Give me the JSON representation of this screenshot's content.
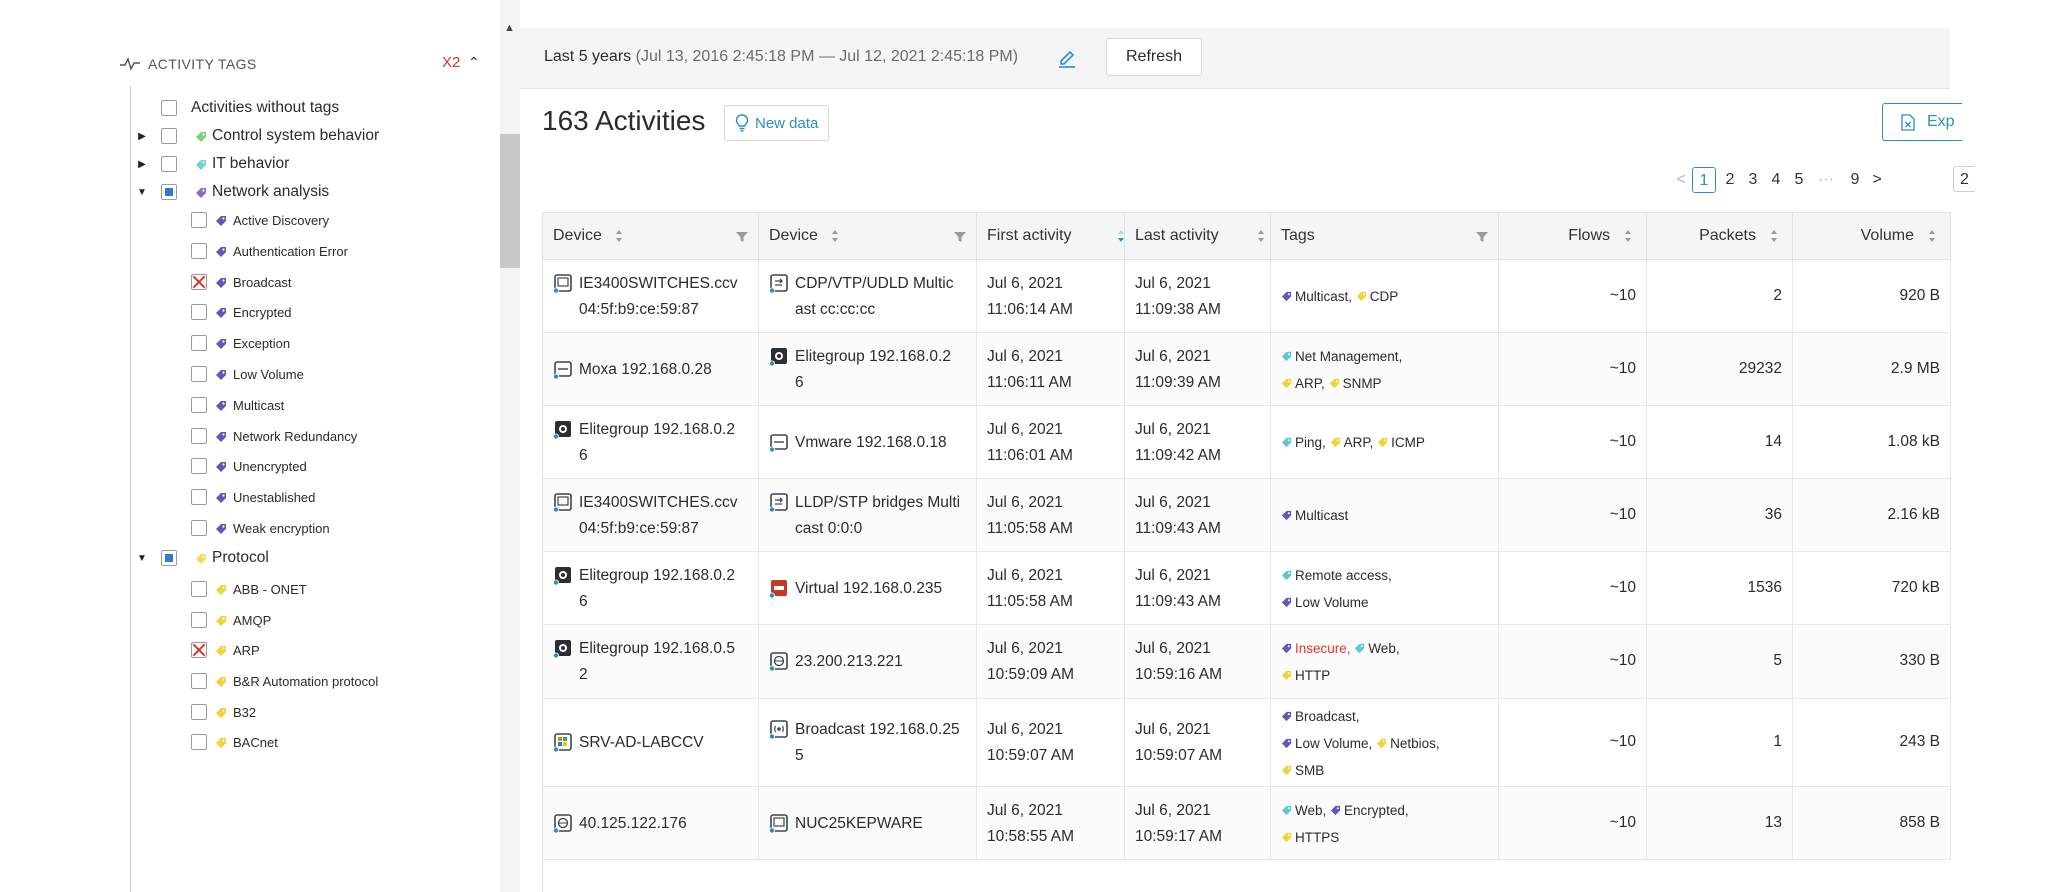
{
  "activity_tags": {
    "header": "ACTIVITY TAGS",
    "filter_count": "X2",
    "items": [
      {
        "label": "Activities without tags",
        "level": 1,
        "expand": "",
        "check": "none",
        "color": ""
      },
      {
        "label": "Control system behavior",
        "level": 1,
        "expand": "collapsed",
        "check": "none",
        "color": "#7ed37a"
      },
      {
        "label": "IT behavior",
        "level": 1,
        "expand": "collapsed",
        "check": "none",
        "color": "#6fd0d8"
      },
      {
        "label": "Network analysis",
        "level": 1,
        "expand": "expanded",
        "check": "partial",
        "color": "#8a6bc9"
      },
      {
        "label": "Active Discovery",
        "level": 2,
        "check": "none",
        "color": "#6a54b8"
      },
      {
        "label": "Authentication Error",
        "level": 2,
        "check": "none",
        "color": "#6a54b8"
      },
      {
        "label": "Broadcast",
        "level": 2,
        "check": "cross",
        "color": "#6a54b8"
      },
      {
        "label": "Encrypted",
        "level": 2,
        "check": "none",
        "color": "#6a54b8"
      },
      {
        "label": "Exception",
        "level": 2,
        "check": "none",
        "color": "#6a54b8"
      },
      {
        "label": "Low Volume",
        "level": 2,
        "check": "none",
        "color": "#6a54b8"
      },
      {
        "label": "Multicast",
        "level": 2,
        "check": "none",
        "color": "#6a54b8"
      },
      {
        "label": "Network Redundancy",
        "level": 2,
        "check": "none",
        "color": "#6a54b8"
      },
      {
        "label": "Unencrypted",
        "level": 2,
        "check": "none",
        "color": "#6a54b8"
      },
      {
        "label": "Unestablished",
        "level": 2,
        "check": "none",
        "color": "#6a54b8"
      },
      {
        "label": "Weak encryption",
        "level": 2,
        "check": "none",
        "color": "#6a54b8"
      },
      {
        "label": "Protocol",
        "level": 1,
        "expand": "expanded",
        "check": "partial",
        "color": "#f5dc5a"
      },
      {
        "label": "ABB - ONET",
        "level": 2,
        "check": "none",
        "color": "#f0d33a"
      },
      {
        "label": "AMQP",
        "level": 2,
        "check": "none",
        "color": "#f0d33a"
      },
      {
        "label": "ARP",
        "level": 2,
        "check": "cross",
        "color": "#f0d33a"
      },
      {
        "label": "B&R Automation protocol",
        "level": 2,
        "check": "none",
        "color": "#f0d33a"
      },
      {
        "label": "B32",
        "level": 2,
        "check": "none",
        "color": "#f0d33a"
      },
      {
        "label": "BACnet",
        "level": 2,
        "check": "none",
        "color": "#f0d33a"
      }
    ]
  },
  "toolbar": {
    "range_main": "Last 5 years",
    "range_sub": "(Jul 13, 2016 2:45:18 PM — Jul 12, 2021 2:45:18 PM)",
    "refresh_label": "Refresh",
    "edit_icon": "pencil-icon"
  },
  "summary": {
    "title": "163 Activities",
    "new_data_label": "New data",
    "export_label": "Exp"
  },
  "pagination": {
    "prev": "<",
    "pages": [
      "1",
      "2",
      "3",
      "4",
      "5"
    ],
    "ellipsis": "···",
    "last_page": "9",
    "next": ">",
    "page_size_fragment": "2",
    "current": "1"
  },
  "table": {
    "columns": [
      {
        "key": "device1",
        "label": "Device",
        "sort": "none",
        "filter": true
      },
      {
        "key": "device2",
        "label": "Device",
        "sort": "none",
        "filter": true
      },
      {
        "key": "first",
        "label": "First activity",
        "sort": "desc",
        "filter": false
      },
      {
        "key": "last",
        "label": "Last activity",
        "sort": "none",
        "filter": false
      },
      {
        "key": "tags",
        "label": "Tags",
        "sort": "",
        "filter": true
      },
      {
        "key": "flows",
        "label": "Flows",
        "sort": "none",
        "filter": false
      },
      {
        "key": "packets",
        "label": "Packets",
        "sort": "none",
        "filter": false
      },
      {
        "key": "volume",
        "label": "Volume",
        "sort": "none",
        "filter": false
      }
    ],
    "rows": [
      {
        "device1": {
          "icon": "switch-icon",
          "line1": "IE3400SWITCHES.ccv",
          "line2": "04:5f:b9:ce:59:87"
        },
        "device2": {
          "icon": "multicast-icon",
          "line1": "CDP/VTP/UDLD Multic",
          "line2": "ast cc:cc:cc"
        },
        "first": [
          "Jul 6, 2021",
          "11:06:14 AM"
        ],
        "last": [
          "Jul 6, 2021",
          "11:09:38 AM"
        ],
        "tags": [
          [
            {
              "label": "Multicast",
              "color": "#6a54b8",
              "sep": ","
            },
            {
              "label": "CDP",
              "color": "#f0d33a",
              "sep": ""
            }
          ]
        ],
        "flows": "~10",
        "packets": "2",
        "volume": "920 B"
      },
      {
        "device1": {
          "icon": "server-icon",
          "line1": "Moxa 192.168.0.28",
          "line2": ""
        },
        "device2": {
          "icon": "plc-icon",
          "line1": "Elitegroup 192.168.0.2",
          "line2": "6"
        },
        "first": [
          "Jul 6, 2021",
          "11:06:11 AM"
        ],
        "last": [
          "Jul 6, 2021",
          "11:09:39 AM"
        ],
        "tags": [
          [
            {
              "label": "Net Management",
              "color": "#5cc8cf",
              "sep": ","
            }
          ],
          [
            {
              "label": "ARP",
              "color": "#f0d33a",
              "sep": ","
            },
            {
              "label": "SNMP",
              "color": "#f0d33a",
              "sep": ""
            }
          ]
        ],
        "flows": "~10",
        "packets": "29232",
        "volume": "2.9 MB"
      },
      {
        "device1": {
          "icon": "plc-icon",
          "line1": "Elitegroup 192.168.0.2",
          "line2": "6"
        },
        "device2": {
          "icon": "server-icon",
          "line1": "Vmware 192.168.0.18",
          "line2": ""
        },
        "first": [
          "Jul 6, 2021",
          "11:06:01 AM"
        ],
        "last": [
          "Jul 6, 2021",
          "11:09:42 AM"
        ],
        "tags": [
          [
            {
              "label": "Ping",
              "color": "#5cc8cf",
              "sep": ","
            },
            {
              "label": "ARP",
              "color": "#f0d33a",
              "sep": ","
            },
            {
              "label": "ICMP",
              "color": "#f0d33a",
              "sep": ""
            }
          ]
        ],
        "flows": "~10",
        "packets": "14",
        "volume": "1.08 kB"
      },
      {
        "device1": {
          "icon": "switch-icon",
          "line1": "IE3400SWITCHES.ccv",
          "line2": "04:5f:b9:ce:59:87"
        },
        "device2": {
          "icon": "multicast-icon",
          "line1": "LLDP/STP bridges Multi",
          "line2": "cast 0:0:0"
        },
        "first": [
          "Jul 6, 2021",
          "11:05:58 AM"
        ],
        "last": [
          "Jul 6, 2021",
          "11:09:43 AM"
        ],
        "tags": [
          [
            {
              "label": "Multicast",
              "color": "#6a54b8",
              "sep": ""
            }
          ]
        ],
        "flows": "~10",
        "packets": "36",
        "volume": "2.16 kB"
      },
      {
        "device1": {
          "icon": "plc-icon",
          "line1": "Elitegroup 192.168.0.2",
          "line2": "6"
        },
        "device2": {
          "icon": "virtual-icon",
          "line1": "Virtual 192.168.0.235",
          "line2": ""
        },
        "first": [
          "Jul 6, 2021",
          "11:05:58 AM"
        ],
        "last": [
          "Jul 6, 2021",
          "11:09:43 AM"
        ],
        "tags": [
          [
            {
              "label": "Remote access",
              "color": "#5cc8cf",
              "sep": ","
            }
          ],
          [
            {
              "label": "Low Volume",
              "color": "#6a54b8",
              "sep": ""
            }
          ]
        ],
        "flows": "~10",
        "packets": "1536",
        "volume": "720 kB"
      },
      {
        "device1": {
          "icon": "plc-icon",
          "line1": "Elitegroup 192.168.0.5",
          "line2": "2"
        },
        "device2": {
          "icon": "external-icon",
          "line1": "23.200.213.221",
          "line2": ""
        },
        "first": [
          "Jul 6, 2021",
          "10:59:09 AM"
        ],
        "last": [
          "Jul 6, 2021",
          "10:59:16 AM"
        ],
        "tags": [
          [
            {
              "label": "Insecure",
              "color": "#6a54b8",
              "sep": ",",
              "red": true
            },
            {
              "label": "Web",
              "color": "#5cc8cf",
              "sep": ","
            }
          ],
          [
            {
              "label": "HTTP",
              "color": "#f0d33a",
              "sep": ""
            }
          ]
        ],
        "flows": "~10",
        "packets": "5",
        "volume": "330 B"
      },
      {
        "device1": {
          "icon": "windows-icon",
          "line1": "SRV-AD-LABCCV",
          "line2": ""
        },
        "device2": {
          "icon": "broadcast-icon",
          "line1": "Broadcast 192.168.0.25",
          "line2": "5"
        },
        "first": [
          "Jul 6, 2021",
          "10:59:07 AM"
        ],
        "last": [
          "Jul 6, 2021",
          "10:59:07 AM"
        ],
        "tags": [
          [
            {
              "label": "Broadcast",
              "color": "#6a54b8",
              "sep": ","
            }
          ],
          [
            {
              "label": "Low Volume",
              "color": "#6a54b8",
              "sep": ","
            },
            {
              "label": "Netbios",
              "color": "#f0d33a",
              "sep": ","
            }
          ],
          [
            {
              "label": "SMB",
              "color": "#f0d33a",
              "sep": ""
            }
          ]
        ],
        "flows": "~10",
        "packets": "1",
        "volume": "243 B"
      },
      {
        "device1": {
          "icon": "external-icon",
          "line1": "40.125.122.176",
          "line2": ""
        },
        "device2": {
          "icon": "switch-icon",
          "line1": "NUC25KEPWARE",
          "line2": ""
        },
        "first": [
          "Jul 6, 2021",
          "10:58:55 AM"
        ],
        "last": [
          "Jul 6, 2021",
          "10:59:17 AM"
        ],
        "tags": [
          [
            {
              "label": "Web",
              "color": "#5cc8cf",
              "sep": ","
            },
            {
              "label": "Encrypted",
              "color": "#6a54b8",
              "sep": ","
            }
          ],
          [
            {
              "label": "HTTPS",
              "color": "#f0d33a",
              "sep": ""
            }
          ]
        ],
        "flows": "~10",
        "packets": "13",
        "volume": "858 B"
      }
    ]
  },
  "colors": {
    "accent": "#2b8ec9",
    "danger": "#e0342e",
    "header_bg": "#f4f5f7"
  }
}
